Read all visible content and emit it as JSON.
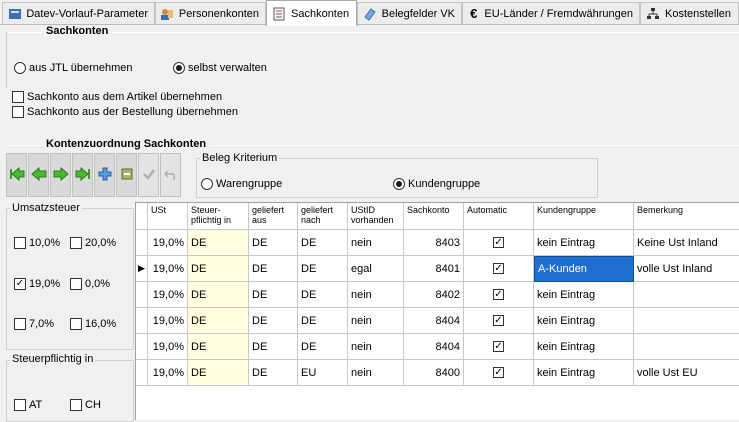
{
  "tabs": [
    {
      "label": "Datev-Vorlauf-Parameter",
      "icon": "datev-icon",
      "active": false
    },
    {
      "label": "Personenkonten",
      "icon": "persons-icon",
      "active": false
    },
    {
      "label": "Sachkonten",
      "icon": "accounts-icon",
      "active": true
    },
    {
      "label": "Belegfelder VK",
      "icon": "document-fields-icon",
      "active": false
    },
    {
      "label": "EU-Länder / Fremdwährungen",
      "icon": "euro-icon",
      "active": false
    },
    {
      "label": "Kostenstellen",
      "icon": "cost-center-icon",
      "active": false
    }
  ],
  "sachkonten": {
    "title": "Sachkonten",
    "radio_jtl": "aus JTL übernehmen",
    "radio_self": "selbst verwalten",
    "selected": "selbst verwalten",
    "check_artikel": "Sachkonto aus dem Artikel übernehmen",
    "check_bestellung": "Sachkonto aus der Bestellung übernehmen"
  },
  "kontenzuordnung": {
    "title": "Kontenzuordnung Sachkonten",
    "beleg_kriterium_label": "Beleg Kriterium",
    "radio_waren": "Warengruppe",
    "radio_kunden": "Kundengruppe",
    "selected": "Kundengruppe"
  },
  "umsatzsteuer": {
    "label": "Umsatzsteuer",
    "options": [
      {
        "label": "10,0%",
        "checked": false
      },
      {
        "label": "20,0%",
        "checked": false
      },
      {
        "label": "19,0%",
        "checked": true
      },
      {
        "label": "0,0%",
        "checked": false
      },
      {
        "label": "7,0%",
        "checked": false
      },
      {
        "label": "16,0%",
        "checked": false
      }
    ]
  },
  "steuerpflichtig": {
    "label": "Steuerpflichtig in",
    "options": [
      {
        "label": "AT",
        "checked": false
      },
      {
        "label": "CH",
        "checked": false
      }
    ]
  },
  "grid": {
    "headers": [
      "USt",
      "Steuer-\npflichtig in",
      "geliefert\naus",
      "geliefert\nnach",
      "UStID\nvorhanden",
      "Sachkonto",
      "Automatic",
      "Kundengruppe",
      "Bemerkung"
    ],
    "rows": [
      {
        "ust": "19,0%",
        "steuer": "DE",
        "aus": "DE",
        "nach": "DE",
        "ustid": "nein",
        "konto": "8403",
        "auto": true,
        "kgruppe": "kein Eintrag",
        "bemerkung": "Keine Ust Inland",
        "current": false
      },
      {
        "ust": "19,0%",
        "steuer": "DE",
        "aus": "DE",
        "nach": "DE",
        "ustid": "egal",
        "konto": "8401",
        "auto": true,
        "kgruppe": "A-Kunden",
        "bemerkung": "volle Ust Inland",
        "current": true
      },
      {
        "ust": "19,0%",
        "steuer": "DE",
        "aus": "DE",
        "nach": "DE",
        "ustid": "nein",
        "konto": "8402",
        "auto": true,
        "kgruppe": "kein Eintrag",
        "bemerkung": "",
        "current": false
      },
      {
        "ust": "19,0%",
        "steuer": "DE",
        "aus": "DE",
        "nach": "DE",
        "ustid": "nein",
        "konto": "8404",
        "auto": true,
        "kgruppe": "kein Eintrag",
        "bemerkung": "",
        "current": false
      },
      {
        "ust": "19,0%",
        "steuer": "DE",
        "aus": "DE",
        "nach": "DE",
        "ustid": "nein",
        "konto": "8404",
        "auto": true,
        "kgruppe": "kein Eintrag",
        "bemerkung": "",
        "current": false
      },
      {
        "ust": "19,0%",
        "steuer": "DE",
        "aus": "DE",
        "nach": "EU",
        "ustid": "nein",
        "konto": "8400",
        "auto": true,
        "kgruppe": "kein Eintrag",
        "bemerkung": "volle Ust EU",
        "current": false
      }
    ]
  },
  "toolbar": [
    "first-record-icon",
    "previous-record-icon",
    "next-record-icon",
    "last-record-icon",
    "add-record-icon",
    "delete-record-icon",
    "save-record-icon",
    "undo-record-icon"
  ]
}
